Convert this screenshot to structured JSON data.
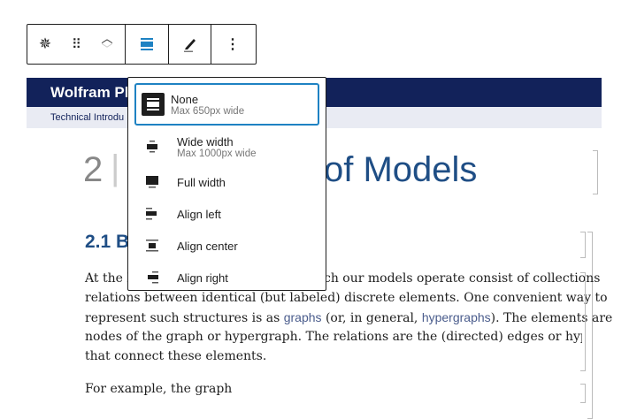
{
  "toolbar": {
    "buttons": [
      {
        "name": "block-type",
        "icon": "wolfram-star-icon"
      },
      {
        "name": "drag",
        "icon": "drag-handle-icon"
      },
      {
        "name": "move",
        "icon": "chevron-up-down-icon"
      },
      {
        "name": "align",
        "icon": "align-none-icon"
      },
      {
        "name": "edit",
        "icon": "pencil-icon"
      },
      {
        "name": "more",
        "icon": "more-vertical-icon"
      }
    ]
  },
  "page": {
    "header_title": "Wolfram Ph",
    "subbar": "Technical Introdu",
    "title_number": "2",
    "title_sep": "|",
    "title_rest": "of Models",
    "section_heading": "2.1 B",
    "para1": {
      "l1a": "At the l",
      "l1b": "ch our models operate consist of collections",
      "l2": "relations between identical (but labeled) discrete elements. One convenient way to",
      "l3a": "represent such structures is as ",
      "l3link1": "graphs",
      "l3b": " (or, in general, ",
      "l3link2": "hypergraphs",
      "l3c": "). The elements are",
      "l4": "nodes of the graph or hypergraph. The relations are the (directed) edges or hyperedg",
      "l5": "that connect these elements."
    },
    "para2": "For example, the graph"
  },
  "dropdown": {
    "options": [
      {
        "label": "None",
        "sub": "Max 650px wide",
        "selected": true
      },
      {
        "label": "Wide width",
        "sub": "Max 1000px wide"
      },
      {
        "label": "Full width"
      },
      {
        "label": "Align left"
      },
      {
        "label": "Align center"
      },
      {
        "label": "Align right"
      }
    ]
  },
  "colors": {
    "accent": "#1e82c3",
    "header": "#12225a",
    "heading": "#1f4e85"
  }
}
